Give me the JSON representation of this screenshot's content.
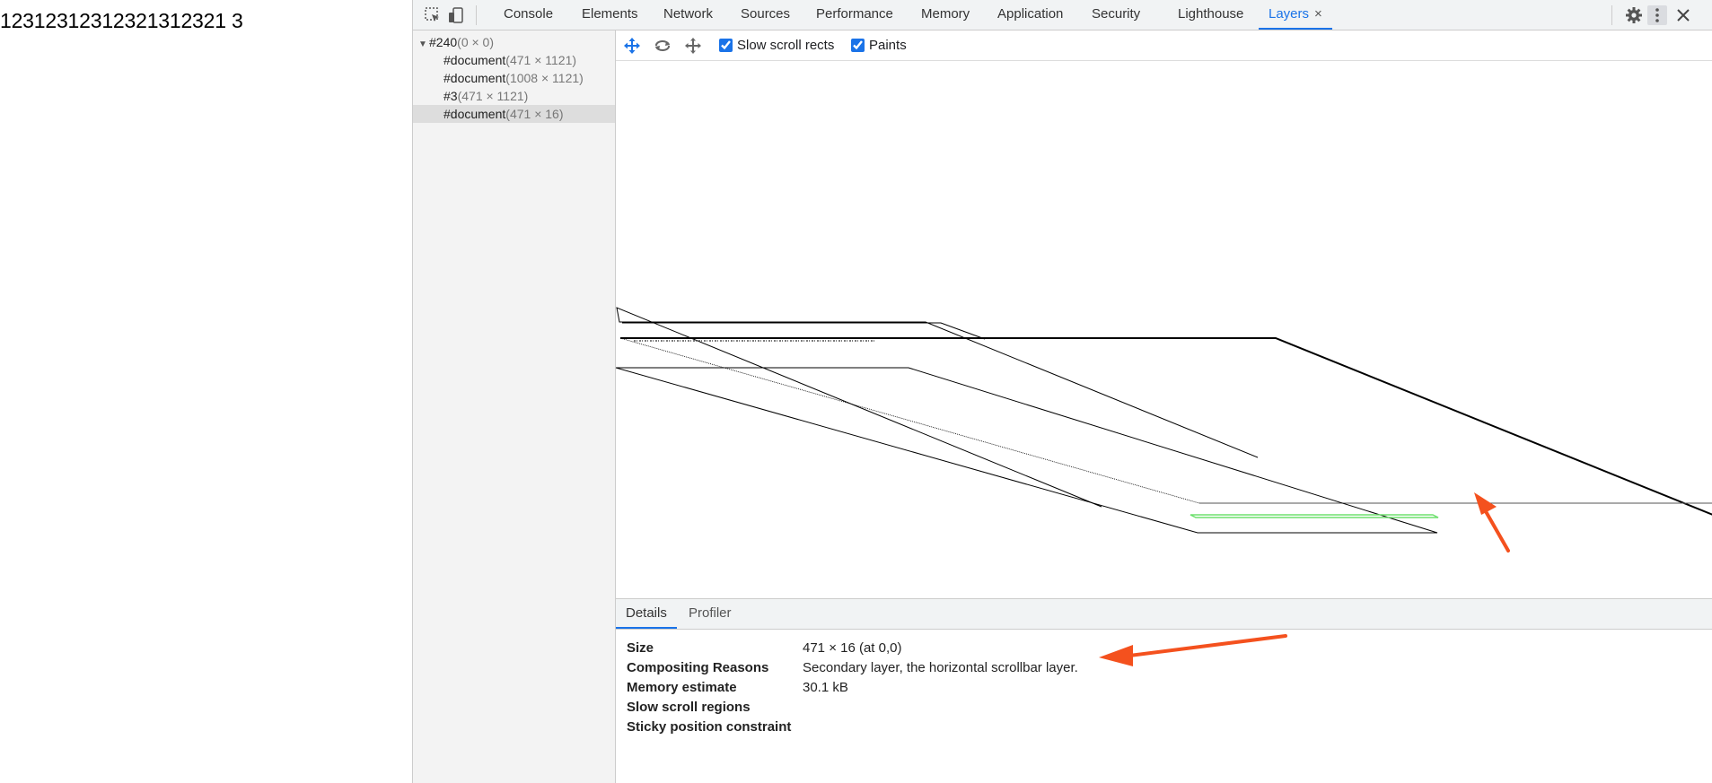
{
  "page": {
    "text": "12312312312321312321 3"
  },
  "devtools": {
    "tabs": [
      {
        "label": "Console"
      },
      {
        "label": "Elements"
      },
      {
        "label": "Network"
      },
      {
        "label": "Sources"
      },
      {
        "label": "Performance"
      },
      {
        "label": "Memory"
      },
      {
        "label": "Application"
      },
      {
        "label": "Security"
      },
      {
        "label": "Lighthouse"
      },
      {
        "label": "Layers",
        "close": "×"
      }
    ],
    "toolbar_icons": [
      "inspect-element-icon",
      "device-toolbar-icon",
      "settings-icon",
      "kebab-menu-icon",
      "close-icon"
    ],
    "layer_tree": [
      {
        "name": "#240",
        "dims": "(0 × 0)",
        "expanded": true
      },
      {
        "name": "#document",
        "dims": "(471 × 1121)"
      },
      {
        "name": "#document",
        "dims": "(1008 × 1121)"
      },
      {
        "name": "#3",
        "dims": "(471 × 1121)"
      },
      {
        "name": "#document",
        "dims": "(471 × 16)",
        "selected": true
      }
    ],
    "viewer_toolbar": {
      "icons": [
        "pan-mode-icon",
        "rotate-mode-icon",
        "reset-transform-icon"
      ],
      "slow_scroll_rects": {
        "label": "Slow scroll rects",
        "checked": true
      },
      "paints": {
        "label": "Paints",
        "checked": true
      }
    },
    "details_tabs": [
      {
        "label": "Details"
      },
      {
        "label": "Profiler"
      }
    ],
    "details": [
      {
        "key": "Size",
        "value": "471 × 16 (at 0,0)"
      },
      {
        "key": "Compositing Reasons",
        "value": "Secondary layer, the horizontal scrollbar layer."
      },
      {
        "key": "Memory estimate",
        "value": "30.1 kB"
      },
      {
        "key": "Slow scroll regions",
        "value": ""
      },
      {
        "key": "Sticky position constraint",
        "value": ""
      }
    ],
    "colors": {
      "accent": "#1a73e8",
      "annotation_arrow": "#f4511e",
      "selected_layer": "#6ee06e"
    }
  }
}
